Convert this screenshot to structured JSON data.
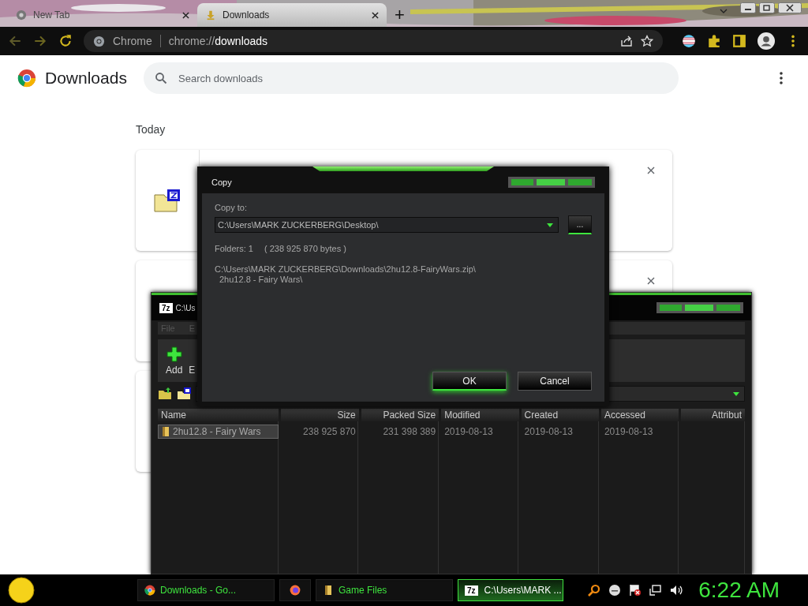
{
  "browser": {
    "tabs": [
      {
        "title": "New Tab",
        "selected": false
      },
      {
        "title": "Downloads",
        "selected": true
      }
    ],
    "new_tab_button": "+",
    "omnibox": {
      "site_label": "Chrome",
      "url_prefix": "chrome://",
      "url_host": "downloads"
    }
  },
  "page": {
    "title": "Downloads",
    "search": {
      "placeholder": "Search downloads"
    },
    "section": "Today",
    "cards": [
      {
        "kind": "zip",
        "closable": true
      },
      {
        "kind": "plain",
        "closable": true
      },
      {
        "kind": "plain"
      }
    ]
  },
  "archive_window": {
    "badge": "7z",
    "title": "C:\\Us",
    "menu": [
      "File",
      "E"
    ],
    "toolbar": [
      {
        "label": "Add",
        "kind": "add"
      },
      {
        "label": "E",
        "kind": "cut"
      }
    ],
    "columns": [
      {
        "label": "Name"
      },
      {
        "label": "Size"
      },
      {
        "label": "Packed Size"
      },
      {
        "label": "Modified"
      },
      {
        "label": "Created"
      },
      {
        "label": "Accessed"
      },
      {
        "label": "Attribut"
      }
    ],
    "rows": [
      {
        "selected": true,
        "cells": [
          "2hu12.8 - Fairy Wars",
          "238 925 870",
          "231 398 389",
          "2019-08-13",
          "2019-08-13",
          "2019-08-13",
          null
        ]
      }
    ]
  },
  "copy_dialog": {
    "title": "Copy",
    "label": "Copy to:",
    "destination": "C:\\Users\\MARK ZUCKERBERG\\Desktop\\",
    "browse_button": "...",
    "summary_count": "Folders: 1",
    "summary_bytes": "( 238 925 870 bytes )",
    "source_lines": [
      "C:\\Users\\MARK ZUCKERBERG\\Downloads\\2hu12.8-FairyWars.zip\\",
      "2hu12.8 - Fairy Wars\\"
    ],
    "buttons": [
      {
        "label": "OK",
        "kind": "default"
      },
      {
        "label": "Cancel",
        "kind": "normal"
      }
    ]
  },
  "taskbar": {
    "items": [
      {
        "kind": "chrome",
        "label": "Downloads - Go...",
        "selected": false
      },
      {
        "kind": "firefox",
        "selected": false
      },
      {
        "kind": "folder",
        "label": "Game Files",
        "selected": false
      },
      {
        "kind": "sevenzip",
        "badge": "7z",
        "label": "C:\\Users\\MARK ...",
        "selected": true
      }
    ],
    "clock": "6:22 AM"
  }
}
